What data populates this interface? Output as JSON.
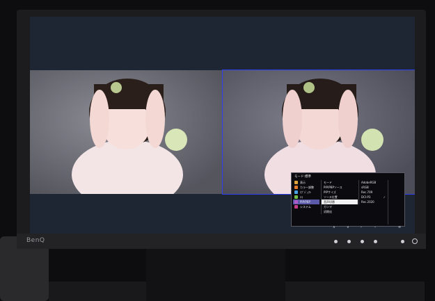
{
  "monitor": {
    "brand": "BenQ"
  },
  "osd": {
    "title": "モード:標準",
    "menu": [
      {
        "label": "表示",
        "color": "#e0a23a",
        "icon": "display-icon"
      },
      {
        "label": "カラー調整",
        "color": "#e07a2a",
        "icon": "color-icon"
      },
      {
        "label": "ｵﾌﾞｼﾞｪｸﾄ",
        "color": "#4aa0e0",
        "icon": "object-icon"
      },
      {
        "label": "ｴｺ",
        "color": "#6fbf4a",
        "icon": "eco-icon"
      },
      {
        "label": "PIP/PBP",
        "color": "#b05ac8",
        "icon": "pip-icon",
        "selected": true
      },
      {
        "label": "システム",
        "color": "#c83a8a",
        "icon": "system-icon"
      }
    ],
    "submenu": [
      "モード",
      "PIP/PBPソース",
      "PIPサイズ",
      "ソース位置",
      "音声切替",
      "ガンマ",
      "初期化"
    ],
    "options": [
      "AdobeRGB",
      "sRGB",
      "Rec.709",
      "DCI-P3",
      "Rec.2020"
    ],
    "selected_submenu": "音声切替",
    "checked_option": "DCI-P3"
  },
  "nav": {
    "up": "∧",
    "down": "∨",
    "enter": "›",
    "back": "‹",
    "exit": "≡"
  }
}
